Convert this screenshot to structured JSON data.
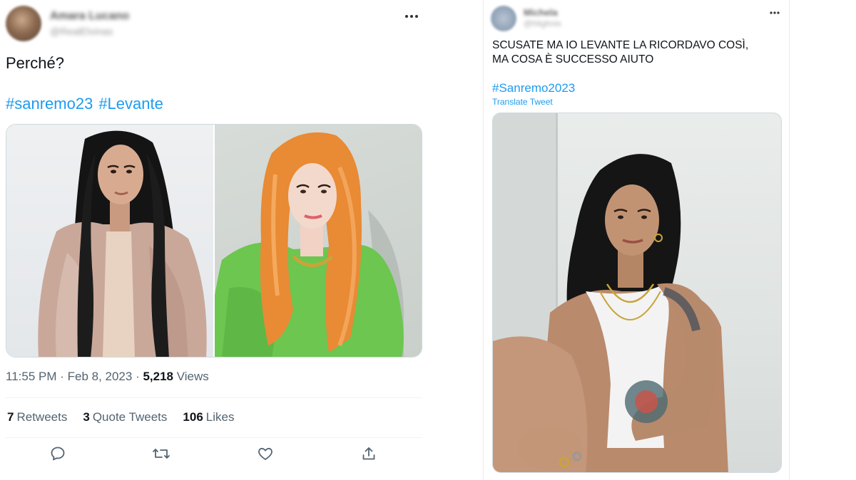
{
  "left_tweet": {
    "author_name": "Amara Lucano",
    "author_handle": "@RealElvinas",
    "more_icon": "more-horizontal-icon",
    "text": "Perché?",
    "hashtags": [
      "#sanremo23",
      "#Levante"
    ],
    "timestamp": "11:55 PM · Feb 8, 2023 · ",
    "views_count": "5,218",
    "views_label": " Views",
    "stats": {
      "retweets_count": "7",
      "retweets_label": "Retweets",
      "quotes_count": "3",
      "quotes_label": "Quote Tweets",
      "likes_count": "106",
      "likes_label": "Likes"
    },
    "action_icons": [
      "reply-icon",
      "retweet-icon",
      "like-icon",
      "share-icon"
    ]
  },
  "right_tweet": {
    "author_name": "Michela",
    "author_handle": "@hlighnis",
    "more_icon": "more-horizontal-icon",
    "text_line1": "SCUSATE MA IO LEVANTE LA RICORDAVO COSÌ,",
    "text_line2": "MA COSA È SUCCESSO AIUTO",
    "hashtag": "#Sanremo2023",
    "translate_label": "Translate Tweet"
  },
  "colors": {
    "link": "#1d9bf0",
    "text_primary": "#0f1419",
    "text_secondary": "#536471",
    "border": "#cfd9de"
  }
}
